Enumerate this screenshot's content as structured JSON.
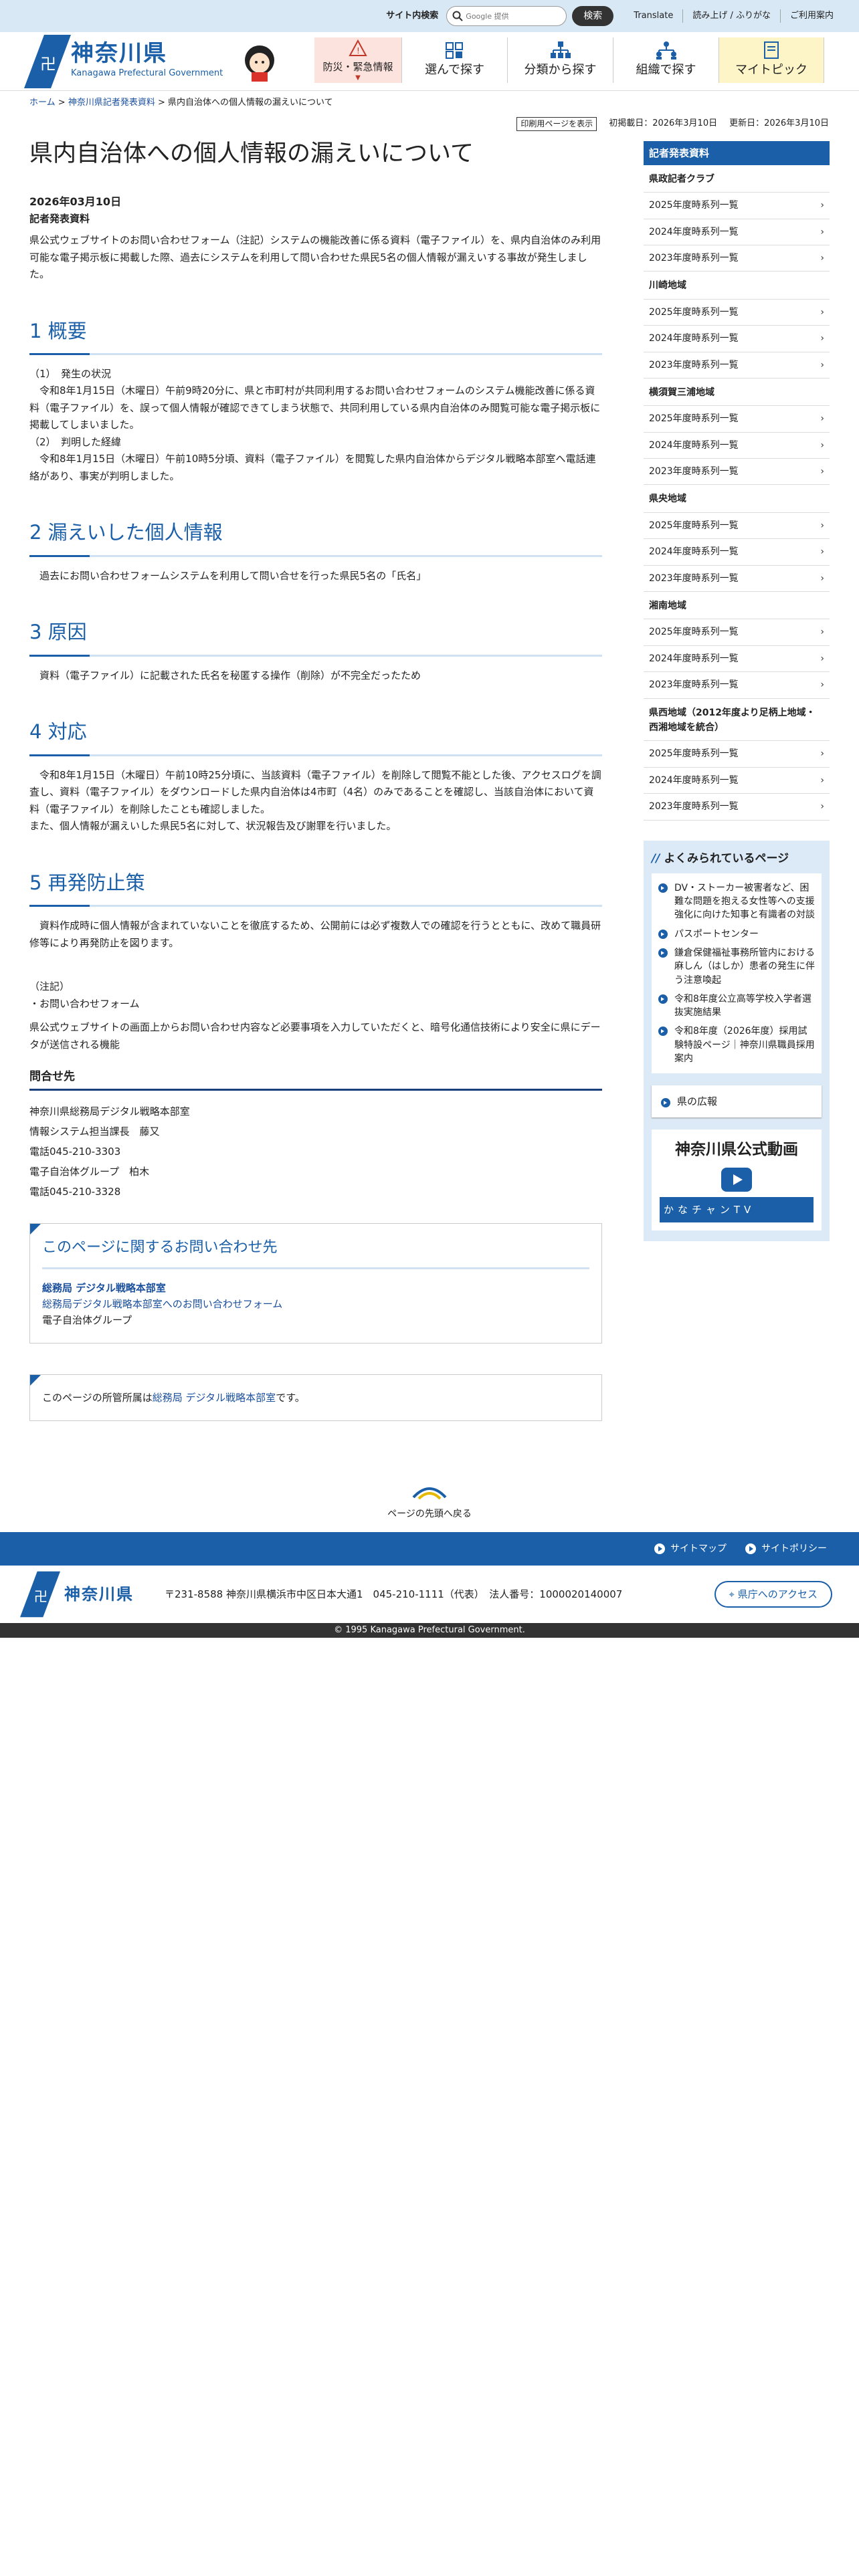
{
  "utility": {
    "search_label": "サイト内検索",
    "search_placeholder": "Google 提供",
    "search_button": "検索",
    "links": [
      "Translate",
      "読み上げ / ふりがな",
      "ご利用案内"
    ]
  },
  "header": {
    "logo_ja": "神奈川県",
    "logo_en": "Kanagawa Prefectural Government",
    "nav": [
      "防災・緊急情報",
      "選んで探す",
      "分類から探す",
      "組織で探す",
      "マイトピック"
    ]
  },
  "breadcrumb": {
    "home": "ホーム",
    "parent": "神奈川県記者発表資料",
    "current": "県内自治体への個人情報の漏えいについて",
    "sep": ">"
  },
  "meta": {
    "print": "印刷用ページを表示",
    "first_pub": "初掲載日：2026年3月10日",
    "updated": "更新日：2026年3月10日"
  },
  "article": {
    "title": "県内自治体への個人情報の漏えいについて",
    "date": "2026年03月10日",
    "category": "記者発表資料",
    "lead": "県公式ウェブサイトのお問い合わせフォーム（注記）システムの機能改善に係る資料（電子ファイル）を、県内自治体のみ利用可能な電子掲示板に掲載した際、過去にシステムを利用して問い合わせた県民5名の個人情報が漏えいする事故が発生しました。",
    "s1_title": "1 概要",
    "s1_sub1": "（1）　発生の状況",
    "s1_p1": "令和8年1月15日（木曜日）午前9時20分に、県と市町村が共同利用するお問い合わせフォームのシステム機能改善に係る資料（電子ファイル）を、誤って個人情報が確認できてしまう状態で、共同利用している県内自治体のみ閲覧可能な電子掲示板に掲載してしまいました。",
    "s1_sub2": "（2）　判明した経緯",
    "s1_p2": "令和8年1月15日（木曜日）午前10時5分頃、資料（電子ファイル）を閲覧した県内自治体からデジタル戦略本部室へ電話連絡があり、事実が判明しました。",
    "s2_title": "2 漏えいした個人情報",
    "s2_p": "過去にお問い合わせフォームシステムを利用して問い合せを行った県民5名の「氏名」",
    "s3_title": "3 原因",
    "s3_p": "資料（電子ファイル）に記載された氏名を秘匿する操作（削除）が不完全だったため",
    "s4_title": "4 対応",
    "s4_p1": "令和8年1月15日（木曜日）午前10時25分頃に、当該資料（電子ファイル）を削除して閲覧不能とした後、アクセスログを調査し、資料（電子ファイル）をダウンロードした県内自治体は4市町（4名）のみであることを確認し、当該自治体において資料（電子ファイル）を削除したことも確認しました。",
    "s4_p2": "また、個人情報が漏えいした県民5名に対して、状況報告及び謝罪を行いました。",
    "s5_title": "5 再発防止策",
    "s5_p": "資料作成時に個人情報が含まれていないことを徹底するため、公開前には必ず複数人での確認を行うとともに、改めて職員研修等により再発防止を図ります。",
    "note_head": "（注記）",
    "note_item": "・お問い合わせフォーム",
    "note_desc": "県公式ウェブサイトの画面上からお問い合わせ内容など必要事項を入力していただくと、暗号化通信技術により安全に県にデータが送信される機能",
    "contact_title": "問合せ先",
    "contact_lines": [
      "神奈川県総務局デジタル戦略本部室",
      "情報システム担当課長　藤又",
      "電話045-210-3303",
      "電子自治体グループ　柏木",
      "電話045-210-3328"
    ]
  },
  "inquiry": {
    "title": "このページに関するお問い合わせ先",
    "dept_link": "総務局 デジタル戦略本部室",
    "form_link": "総務局デジタル戦略本部室へのお問い合わせフォーム",
    "group": "電子自治体グループ"
  },
  "dept": {
    "prefix": "このページの所管所属は",
    "link": "総務局 デジタル戦略本部室",
    "suffix": "です。"
  },
  "sidebar": {
    "head": "記者発表資料",
    "groups": [
      {
        "name": "県政記者クラブ",
        "items": [
          "2025年度時系列一覧",
          "2024年度時系列一覧",
          "2023年度時系列一覧"
        ]
      },
      {
        "name": "川崎地域",
        "items": [
          "2025年度時系列一覧",
          "2024年度時系列一覧",
          "2023年度時系列一覧"
        ]
      },
      {
        "name": "横須賀三浦地域",
        "items": [
          "2025年度時系列一覧",
          "2024年度時系列一覧",
          "2023年度時系列一覧"
        ]
      },
      {
        "name": "県央地域",
        "items": [
          "2025年度時系列一覧",
          "2024年度時系列一覧",
          "2023年度時系列一覧"
        ]
      },
      {
        "name": "湘南地域",
        "items": [
          "2025年度時系列一覧",
          "2024年度時系列一覧",
          "2023年度時系列一覧"
        ]
      },
      {
        "name": "県西地域（2012年度より足柄上地域・西湘地域を統合）",
        "items": [
          "2025年度時系列一覧",
          "2024年度時系列一覧",
          "2023年度時系列一覧"
        ]
      }
    ],
    "faq_title": "よくみられているページ",
    "faq": [
      "DV・ストーカー被害者など、困難な問題を抱える女性等への支援強化に向けた知事と有識者の対談",
      "パスポートセンター",
      "鎌倉保健福祉事務所管内における麻しん（はしか）患者の発生に伴う注意喚起",
      "令和8年度公立高等学校入学者選抜実施結果",
      "令和8年度（2026年度）採用試験特設ページ｜神奈川県職員採用案内"
    ],
    "koho": "県の広報",
    "video_title": "神奈川県公式動画",
    "tv_label": "かなチャンTV"
  },
  "footer": {
    "totop": "ページの先頭へ戻る",
    "nav": [
      "サイトマップ",
      "サイトポリシー"
    ],
    "logo": "神奈川県",
    "address": "〒231-8588 神奈川県横浜市中区日本大通1　045-210-1111（代表）　法人番号：1000020140007",
    "access": "県庁へのアクセス",
    "copyright": "© 1995 Kanagawa Prefectural Government."
  },
  "colors": {
    "brand": "#1a5fa8",
    "disaster_bg": "#fde3dd",
    "mytopic_bg": "#fdf4c7"
  }
}
